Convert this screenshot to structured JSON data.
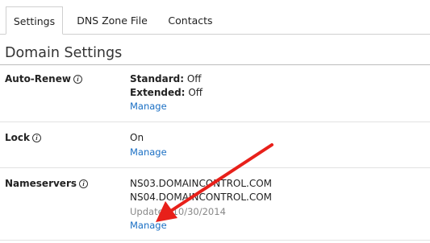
{
  "tabs": [
    {
      "label": "Settings",
      "active": true
    },
    {
      "label": "DNS Zone File",
      "active": false
    },
    {
      "label": "Contacts",
      "active": false
    }
  ],
  "section": {
    "title": "Domain Settings"
  },
  "rows": {
    "auto_renew": {
      "label": "Auto-Renew",
      "standard_key": "Standard:",
      "standard_value": "Off",
      "extended_key": "Extended:",
      "extended_value": "Off",
      "link": "Manage"
    },
    "lock": {
      "label": "Lock",
      "value": "On",
      "link": "Manage"
    },
    "nameservers": {
      "label": "Nameservers",
      "ns1": "NS03.DOMAINCONTROL.COM",
      "ns2": "NS04.DOMAINCONTROL.COM",
      "updated": "Updated 10/30/2014",
      "link": "Manage"
    }
  },
  "icons": {
    "info": "info-icon",
    "annotation": "red-arrow"
  },
  "colors": {
    "link": "#1a6fc4",
    "annotation_arrow": "#e8201a",
    "border": "#cfcfcf"
  }
}
